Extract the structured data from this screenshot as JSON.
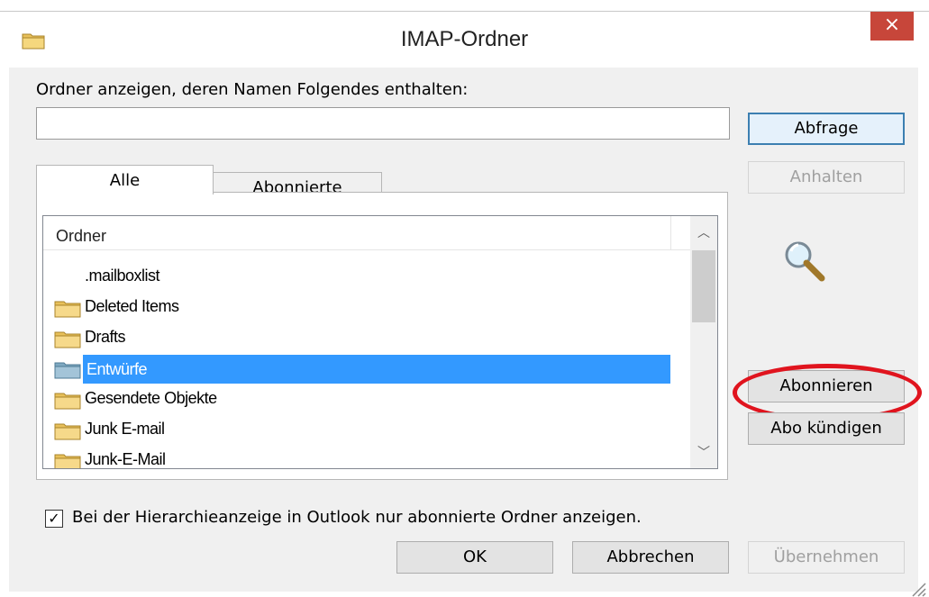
{
  "window": {
    "title": "IMAP-Ordner",
    "close_glyph": "×"
  },
  "search": {
    "label": "Ordner anzeigen, deren Namen Folgendes enthalten:",
    "value": ""
  },
  "buttons": {
    "query": "Abfrage",
    "stop": "Anhalten",
    "subscribe": "Abonnieren",
    "unsubscribe": "Abo kündigen",
    "ok": "OK",
    "cancel": "Abbrechen",
    "apply": "Übernehmen"
  },
  "tabs": [
    {
      "label": "Alle",
      "active": true
    },
    {
      "label": "Abonnierte",
      "active": false
    }
  ],
  "list": {
    "column_header": "Ordner",
    "rows": [
      {
        "label": ".mailboxlist",
        "icon": "none",
        "selected": false
      },
      {
        "label": "Deleted Items",
        "icon": "folder-icon",
        "selected": false
      },
      {
        "label": "Drafts",
        "icon": "folder-icon",
        "selected": false
      },
      {
        "label": "Entwürfe",
        "icon": "folder-icon",
        "selected": true
      },
      {
        "label": "Gesendete Objekte",
        "icon": "folder-icon",
        "selected": false
      },
      {
        "label": "Junk E-mail",
        "icon": "folder-icon",
        "selected": false
      },
      {
        "label": "Junk-E-Mail",
        "icon": "folder-icon",
        "selected": false
      }
    ]
  },
  "checkbox": {
    "label": "Bei der Hierarchieanzeige in Outlook nur abonnierte Ordner anzeigen.",
    "checked": true,
    "glyph": "✓"
  },
  "colors": {
    "selection": "#3399ff",
    "highlight_ellipse": "#e0141e",
    "close_button": "#c7463a",
    "default_button_border": "#3c7fb1"
  }
}
